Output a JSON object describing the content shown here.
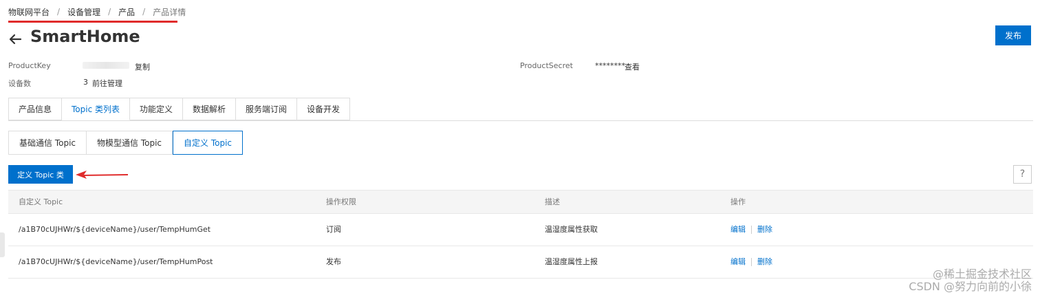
{
  "breadcrumb": {
    "items": [
      "物联网平台",
      "设备管理",
      "产品"
    ],
    "current": "产品详情",
    "separator": "/"
  },
  "header": {
    "title": "SmartHome",
    "publish_label": "发布"
  },
  "info": {
    "product_key_label": "ProductKey",
    "copy_label": "复制",
    "product_secret_label": "ProductSecret",
    "product_secret_value": "********",
    "view_label": "查看",
    "device_count_label": "设备数",
    "device_count_value": "3",
    "manage_label": "前往管理"
  },
  "main_tabs": [
    {
      "label": "产品信息",
      "active": false
    },
    {
      "label": "Topic 类列表",
      "active": true
    },
    {
      "label": "功能定义",
      "active": false
    },
    {
      "label": "数据解析",
      "active": false
    },
    {
      "label": "服务端订阅",
      "active": false
    },
    {
      "label": "设备开发",
      "active": false
    }
  ],
  "sub_tabs": [
    {
      "label": "基础通信 Topic",
      "active": false
    },
    {
      "label": "物模型通信 Topic",
      "active": false
    },
    {
      "label": "自定义 Topic",
      "active": true
    }
  ],
  "toolbar": {
    "define_label": "定义 Topic 类",
    "help_label": "?"
  },
  "table": {
    "headers": [
      "自定义 Topic",
      "操作权限",
      "描述",
      "操作"
    ],
    "rows": [
      {
        "topic": "/a1B70cUJHWr/${deviceName}/user/TempHumGet",
        "permission": "订阅",
        "description": "温湿度属性获取",
        "edit": "编辑",
        "delete": "删除"
      },
      {
        "topic": "/a1B70cUJHWr/${deviceName}/user/TempHumPost",
        "permission": "发布",
        "description": "温湿度属性上报",
        "edit": "编辑",
        "delete": "删除"
      }
    ]
  },
  "watermark": {
    "line1": "@稀土掘金技术社区",
    "line2": "CSDN @努力向前的小徐"
  },
  "colors": {
    "accent": "#0070cc",
    "annotation_red": "#e02b2b"
  }
}
